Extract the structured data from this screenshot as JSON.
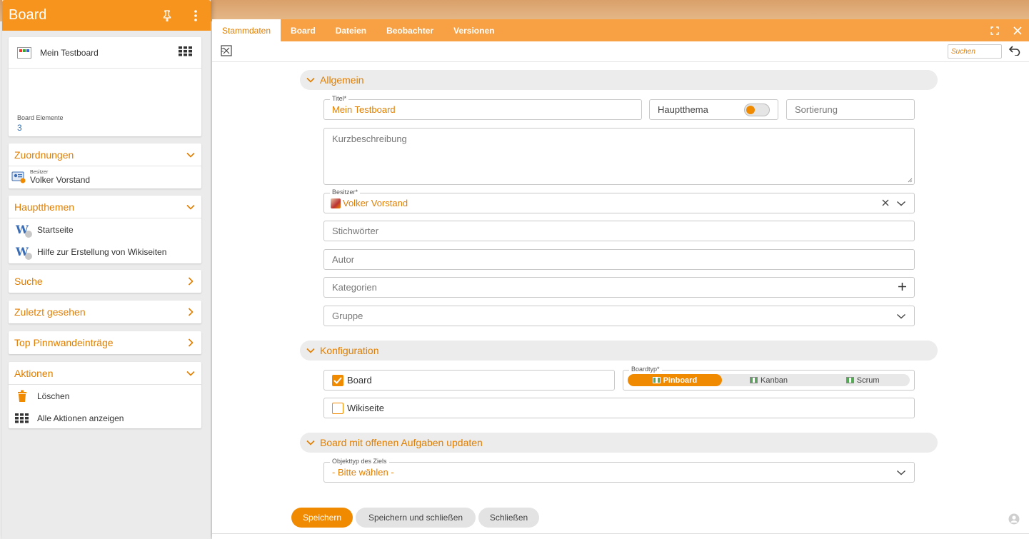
{
  "left": {
    "title": "Board",
    "board_card": {
      "name": "Mein Testboard",
      "elements_label": "Board Elemente",
      "elements_count": "3"
    },
    "assignments": {
      "title": "Zuordnungen",
      "owner_label": "Besitzer",
      "owner_name": "Volker Vorstand"
    },
    "main_topics": {
      "title": "Hauptthemen",
      "items": [
        "Startseite",
        "Hilfe zur Erstellung von Wikiseiten"
      ]
    },
    "search": {
      "title": "Suche"
    },
    "recent": {
      "title": "Zuletzt gesehen"
    },
    "top_pins": {
      "title": "Top Pinnwandeinträge"
    },
    "actions": {
      "title": "Aktionen",
      "items": [
        "Löschen",
        "Alle Aktionen anzeigen"
      ]
    }
  },
  "right": {
    "tabs": [
      "Stammdaten",
      "Board",
      "Dateien",
      "Beobachter",
      "Versionen"
    ],
    "search_placeholder": "Suchen",
    "sections": {
      "general": "Allgemein",
      "config": "Konfiguration",
      "update": "Board mit offenen Aufgaben updaten"
    },
    "form": {
      "title_label": "Titel*",
      "title_value": "Mein Testboard",
      "main_topic_label": "Hauptthema",
      "sort_placeholder": "Sortierung",
      "short_desc_placeholder": "Kurzbeschreibung",
      "owner_label": "Besitzer*",
      "owner_value": "Volker Vorstand",
      "keywords_placeholder": "Stichwörter",
      "author_placeholder": "Autor",
      "categories_placeholder": "Kategorien",
      "group_placeholder": "Gruppe",
      "board_checkbox": "Board",
      "boardtype_label": "Boardtyp*",
      "boardtypes": [
        "Pinboard",
        "Kanban",
        "Scrum"
      ],
      "boardtype_selected": "Pinboard",
      "wiki_checkbox": "Wikiseite",
      "target_type_label": "Objekttyp des Ziels",
      "target_type_value": "- Bitte wählen -"
    },
    "buttons": {
      "save": "Speichern",
      "save_close": "Speichern und schließen",
      "close": "Schließen"
    }
  },
  "colors": {
    "accent": "#f08a00",
    "header": "#f7941d",
    "tabbar": "#f7a144"
  }
}
